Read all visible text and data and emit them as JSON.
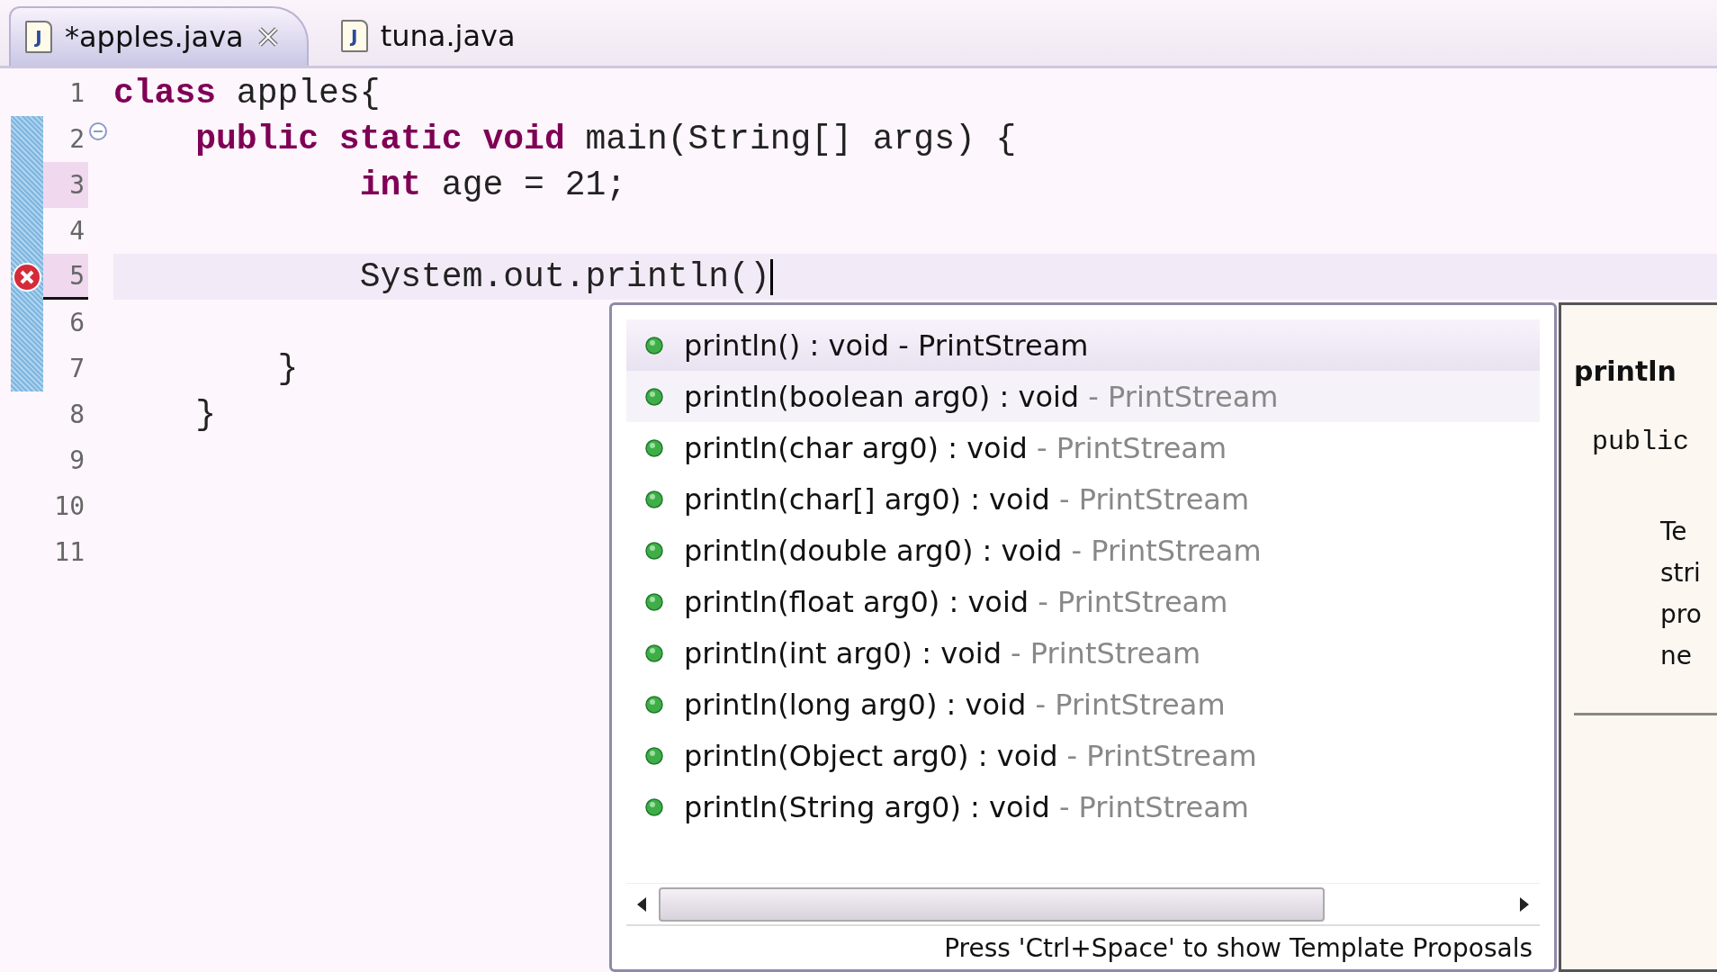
{
  "tabs": [
    {
      "icon": "J",
      "label": "*apples.java",
      "selected": true
    },
    {
      "icon": "J",
      "label": "tuna.java",
      "selected": false
    }
  ],
  "editor": {
    "lines": [
      {
        "number": "1",
        "diff": false,
        "changed": false,
        "error": false,
        "current": false,
        "fold": false,
        "segments": [
          {
            "kind": "keyword",
            "text": "class"
          },
          {
            "kind": "plain",
            "text": " apples{"
          }
        ]
      },
      {
        "number": "2",
        "diff": true,
        "changed": false,
        "error": false,
        "current": false,
        "fold": true,
        "segments": [
          {
            "kind": "keyword",
            "text": "    public static void"
          },
          {
            "kind": "plain",
            "text": " main(String[] args) {"
          }
        ]
      },
      {
        "number": "3",
        "diff": true,
        "changed": true,
        "error": false,
        "current": false,
        "fold": false,
        "segments": [
          {
            "kind": "keyword",
            "text": "            int"
          },
          {
            "kind": "plain",
            "text": " age = 21;"
          }
        ]
      },
      {
        "number": "4",
        "diff": true,
        "changed": false,
        "error": false,
        "current": false,
        "fold": false
      },
      {
        "number": "5",
        "diff": true,
        "changed": true,
        "error": true,
        "current": true,
        "fold": false,
        "segments": [
          {
            "kind": "plain",
            "text": "            System.out.println()"
          }
        ]
      },
      {
        "number": "6",
        "diff": true,
        "changed": false,
        "error": false,
        "current": false,
        "fold": false
      },
      {
        "number": "7",
        "diff": true,
        "changed": false,
        "error": false,
        "current": false,
        "fold": false,
        "segments": [
          {
            "kind": "plain",
            "text": "        }"
          }
        ]
      },
      {
        "number": "8",
        "diff": false,
        "changed": false,
        "error": false,
        "current": false,
        "fold": false,
        "segments": [
          {
            "kind": "plain",
            "text": "    }"
          }
        ]
      },
      {
        "number": "9",
        "diff": false,
        "changed": false,
        "error": false,
        "current": false,
        "fold": false
      },
      {
        "number": "10",
        "diff": false,
        "changed": false,
        "error": false,
        "current": false,
        "fold": false
      },
      {
        "number": "11",
        "diff": false,
        "changed": false,
        "error": false,
        "current": false,
        "fold": false
      }
    ]
  },
  "proposals": {
    "items": [
      {
        "signature": "println() : void",
        "owner": "- PrintStream",
        "selected": true,
        "hovered": false
      },
      {
        "signature": "println(boolean arg0) : void",
        "owner": "- PrintStream",
        "selected": false,
        "hovered": true
      },
      {
        "signature": "println(char arg0) : void",
        "owner": "- PrintStream",
        "selected": false,
        "hovered": false
      },
      {
        "signature": "println(char[] arg0) : void",
        "owner": "- PrintStream",
        "selected": false,
        "hovered": false
      },
      {
        "signature": "println(double arg0) : void",
        "owner": "- PrintStream",
        "selected": false,
        "hovered": false
      },
      {
        "signature": "println(float arg0) : void",
        "owner": "- PrintStream",
        "selected": false,
        "hovered": false
      },
      {
        "signature": "println(int arg0) : void",
        "owner": "- PrintStream",
        "selected": false,
        "hovered": false
      },
      {
        "signature": "println(long arg0) : void",
        "owner": "- PrintStream",
        "selected": false,
        "hovered": false
      },
      {
        "signature": "println(Object arg0) : void",
        "owner": "- PrintStream",
        "selected": false,
        "hovered": false
      },
      {
        "signature": "println(String arg0) : void",
        "owner": "- PrintStream",
        "selected": false,
        "hovered": false
      }
    ],
    "hint": "Press 'Ctrl+Space' to show Template Proposals"
  },
  "doc": {
    "title": "println",
    "code": "public",
    "text_lines": [
      "Te",
      "stri",
      "pro",
      "ne"
    ]
  }
}
